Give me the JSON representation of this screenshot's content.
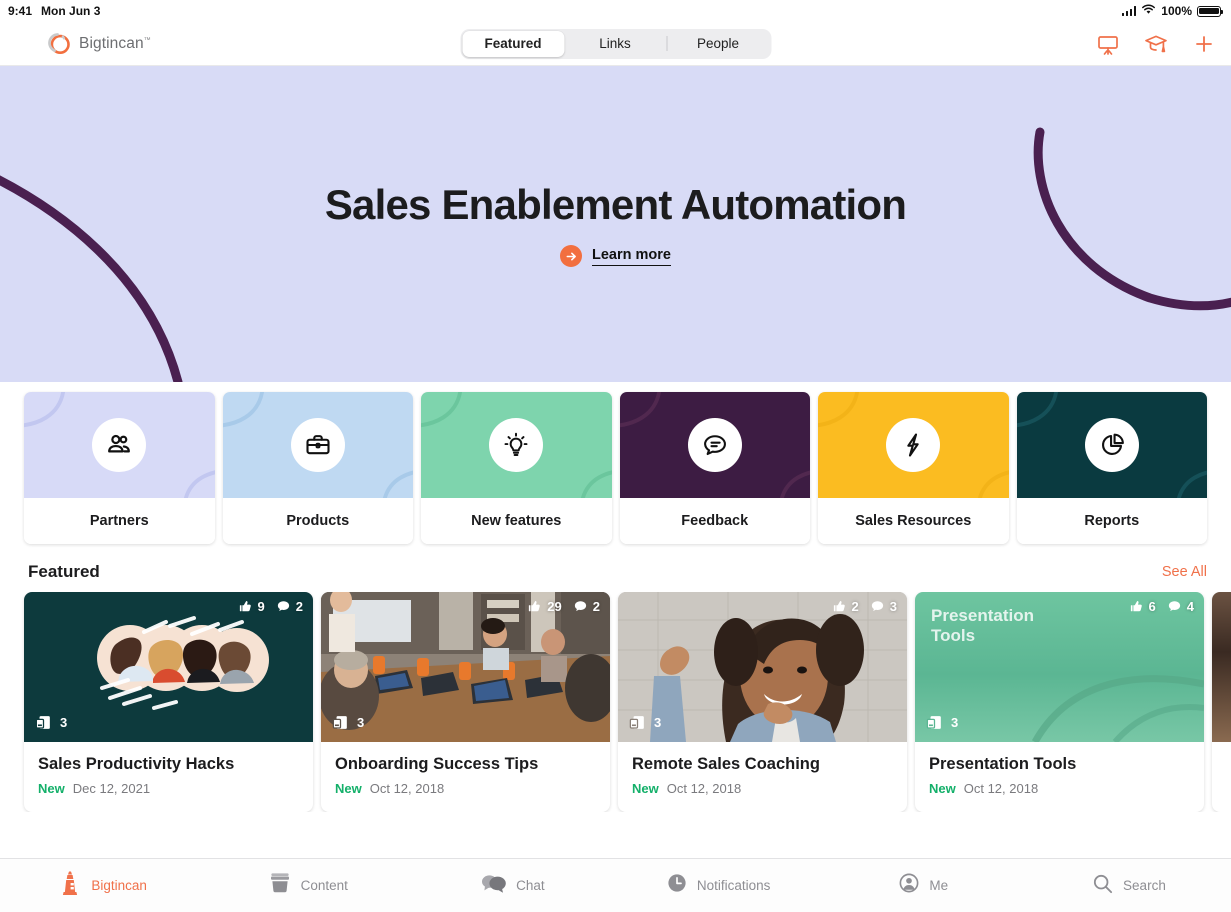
{
  "statusbar": {
    "time": "9:41",
    "date": "Mon Jun 3",
    "battery_percent": "100%",
    "wifi_icon": "wifi-icon",
    "signal_icon": "cellular-signal-icon",
    "battery_icon": "battery-icon"
  },
  "header": {
    "brand": "Bigtincan",
    "brand_tm": "™",
    "logo_icon": "bigtincan-logo-icon",
    "tabs": [
      {
        "label": "Featured",
        "active": true
      },
      {
        "label": "Links",
        "active": false
      },
      {
        "label": "People",
        "active": false
      }
    ],
    "actions": [
      {
        "name": "present-icon",
        "label": "Present"
      },
      {
        "name": "graduation-cap-icon",
        "label": "Learning"
      },
      {
        "name": "plus-icon",
        "label": "Add"
      }
    ],
    "accent": "#f0714a"
  },
  "hero": {
    "title": "Sales Enablement Automation",
    "cta_label": "Learn more",
    "cta_icon": "arrow-right-circle-icon",
    "background": "#d8dbf6",
    "stroke_color": "#4a2050",
    "accent": "#f26f3f"
  },
  "tiles": [
    {
      "label": "Partners",
      "icon": "people-icon",
      "color": "#d7daf7",
      "deco": "#c2c7f0"
    },
    {
      "label": "Products",
      "icon": "briefcase-icon",
      "color": "#bfd9f2",
      "deco": "#a8cae9"
    },
    {
      "label": "New features",
      "icon": "lightbulb-icon",
      "color": "#7ed4ad",
      "deco": "#6bc69d"
    },
    {
      "label": "Feedback",
      "icon": "speech-bubble-icon",
      "color": "#3d1c43",
      "deco": "#51284f"
    },
    {
      "label": "Sales Resources",
      "icon": "lightning-bolt-icon",
      "color": "#fbbc21",
      "deco": "#f3b318"
    },
    {
      "label": "Reports",
      "icon": "pie-chart-icon",
      "color": "#0a3a40",
      "deco": "#155058"
    }
  ],
  "featured": {
    "title": "Featured",
    "see_all": "See All",
    "see_all_color": "#f0714a",
    "cards": [
      {
        "title": "Sales Productivity Hacks",
        "badge": "New",
        "date": "Dec 12, 2021",
        "likes": "9",
        "comments": "2",
        "documents": "3",
        "thumb_kind": "avatars",
        "thumb_color": "#0d3a3d",
        "overlay_title": ""
      },
      {
        "title": "Onboarding Success Tips",
        "badge": "New",
        "date": "Oct 12, 2018",
        "likes": "29",
        "comments": "2",
        "documents": "3",
        "thumb_kind": "photo-meeting",
        "thumb_color": "#8a7a6d",
        "overlay_title": ""
      },
      {
        "title": "Remote Sales Coaching",
        "badge": "New",
        "date": "Oct 12, 2018",
        "likes": "2",
        "comments": "3",
        "documents": "3",
        "thumb_kind": "photo-portrait",
        "thumb_color": "#b4b0ab",
        "overlay_title": ""
      },
      {
        "title": "Presentation Tools",
        "badge": "New",
        "date": "Oct 12, 2018",
        "likes": "6",
        "comments": "4",
        "documents": "3",
        "thumb_kind": "gradient-green",
        "thumb_color": "#62bd97",
        "overlay_title": "Presentation Tools"
      }
    ],
    "icons": {
      "like": "thumbs-up-icon",
      "comment": "comment-bubble-icon",
      "document": "document-stack-icon"
    }
  },
  "tabbar": {
    "items": [
      {
        "label": "Bigtincan",
        "icon": "bigtincan-tin-icon",
        "active": true
      },
      {
        "label": "Content",
        "icon": "content-box-icon",
        "active": false
      },
      {
        "label": "Chat",
        "icon": "chat-bubbles-icon",
        "active": false
      },
      {
        "label": "Notifications",
        "icon": "clock-icon",
        "active": false
      },
      {
        "label": "Me",
        "icon": "person-circle-icon",
        "active": false
      },
      {
        "label": "Search",
        "icon": "search-icon",
        "active": false
      }
    ],
    "active_color": "#f0714a",
    "inactive_color": "#8e8e93"
  }
}
